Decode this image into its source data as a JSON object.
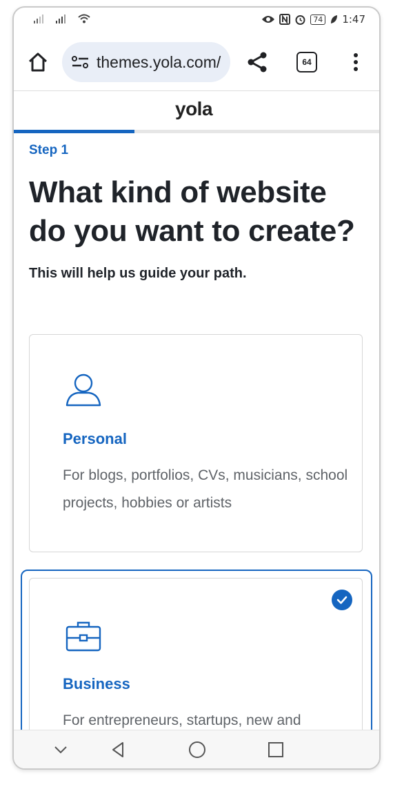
{
  "status_bar": {
    "time": "1:47",
    "battery": "74",
    "icons": [
      "signal-icon",
      "signal-icon",
      "wifi-icon",
      "eye-icon",
      "nfc-icon",
      "alarm-icon",
      "battery-icon",
      "leaf-icon"
    ]
  },
  "browser": {
    "url": "themes.yola.com/",
    "tab_count": "64",
    "icons": [
      "home-icon",
      "site-settings-icon",
      "share-icon",
      "tabs-icon",
      "more-vert-icon"
    ]
  },
  "site": {
    "logo": "yola",
    "progress": 0.33
  },
  "page": {
    "step": "Step 1",
    "title": "What kind of website do you want to create?",
    "subtitle": "This will help us guide your path."
  },
  "options": [
    {
      "title": "Personal",
      "description": "For blogs, portfolios, CVs, musicians, school projects, hobbies or artists",
      "icon": "person-icon",
      "selected": false
    },
    {
      "title": "Business",
      "description": "For entrepreneurs, startups, new and",
      "icon": "briefcase-icon",
      "selected": true
    }
  ],
  "colors": {
    "accent": "#1565c0",
    "text": "#1f2329",
    "muted": "#5f6368",
    "pill": "#e9eef7"
  },
  "nav_bar": {
    "icons": [
      "chevron-down-icon",
      "back-icon",
      "home-circle-icon",
      "recents-icon"
    ]
  }
}
